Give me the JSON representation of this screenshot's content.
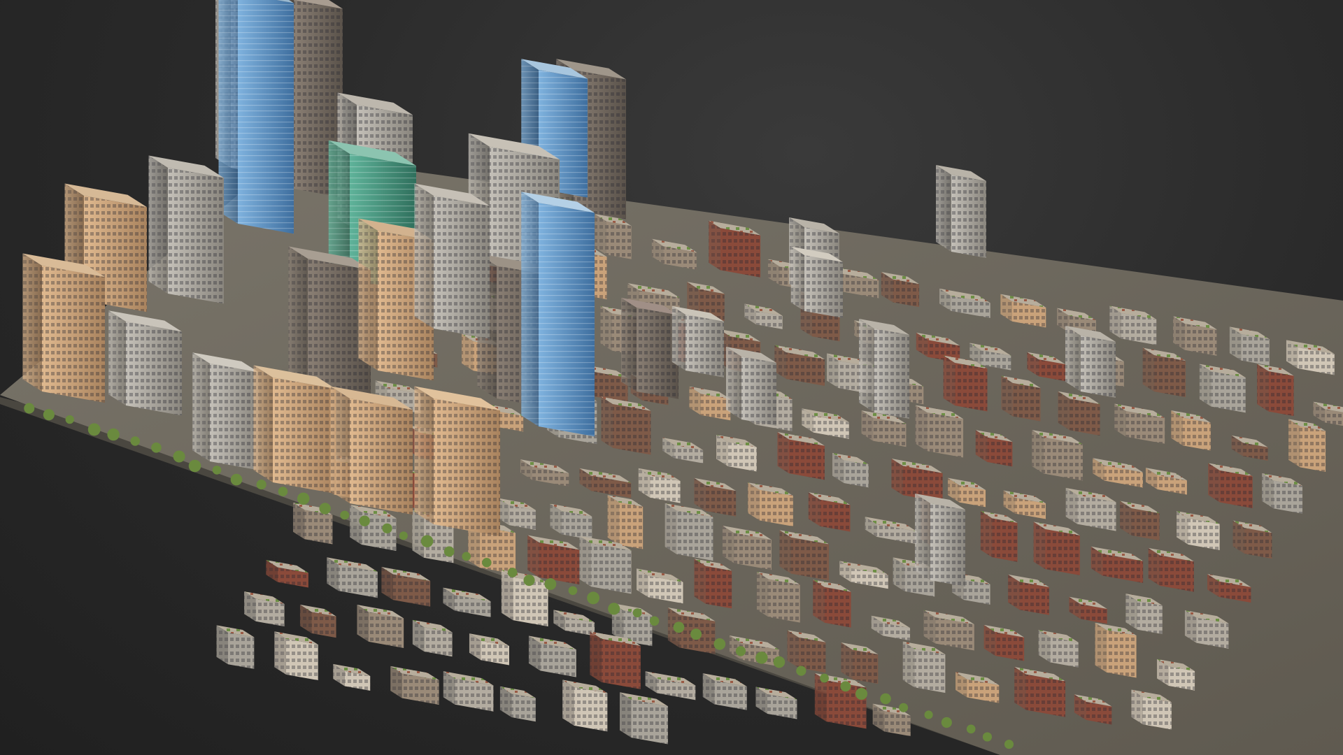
{
  "scene": {
    "subject": "",
    "colors": {
      "background": "#2b2b2b",
      "ground": "#6f6b62",
      "street": "#8a7f6a",
      "tree": "#5f7f3a",
      "glass_blue": "#5a8fc0",
      "glass_green": "#3f8f78",
      "brick": "#8a4a3a",
      "tan": "#c9a27a",
      "concrete": "#a9a49a"
    }
  }
}
